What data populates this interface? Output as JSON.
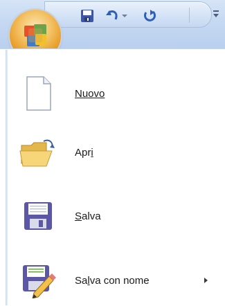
{
  "menu": {
    "items": [
      {
        "id": "new",
        "label": "Nuovo",
        "mnemonic_index": 0,
        "has_submenu": false
      },
      {
        "id": "open",
        "label": "Apri",
        "mnemonic_index": 2,
        "has_submenu": false
      },
      {
        "id": "save",
        "label": "Salva",
        "mnemonic_index": 0,
        "has_submenu": false
      },
      {
        "id": "save-as",
        "label": "Salva con nome",
        "mnemonic_index": 2,
        "has_submenu": true
      }
    ]
  },
  "quick_access_toolbar": {
    "icons": [
      "save-icon",
      "undo-icon",
      "undo-dropdown-icon",
      "redo-icon",
      "customize-dropdown-icon"
    ]
  },
  "colors": {
    "title_bar": "#c6d9f2",
    "orb": "#e89a24",
    "menu_bg": "#ffffff",
    "text": "#1a1a1a"
  }
}
